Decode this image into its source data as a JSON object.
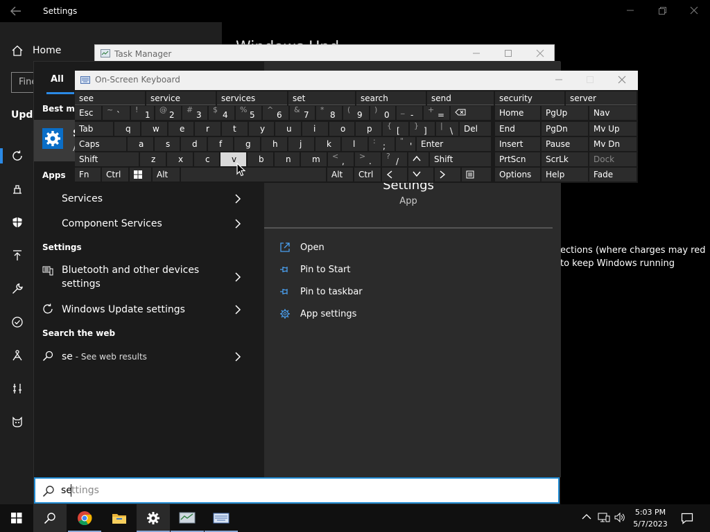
{
  "settings": {
    "title": "Settings",
    "home_label": "Home",
    "find_placeholder": "Fine",
    "section_heading": "Upda",
    "bg_heading": "Windows Upd",
    "bg_text": "ections (where charges may red to keep Windows running"
  },
  "task_manager": {
    "title": "Task Manager"
  },
  "start_menu": {
    "tab_all": "All",
    "best_match_label": "Best ma",
    "best_match_name": "S",
    "best_match_sub": "A",
    "apps_label": "Apps",
    "apps": [
      {
        "label": "Services"
      },
      {
        "label": "Component Services"
      }
    ],
    "settings_label": "Settings",
    "settings_items": [
      {
        "label": "Bluetooth and other devices",
        "label2": "settings"
      },
      {
        "label": "Windows Update settings"
      }
    ],
    "web_label": "Search the web",
    "web_query": "se",
    "web_suffix": " - See web results",
    "preview": {
      "title": "Settings",
      "subtitle": "App",
      "actions": [
        {
          "label": "Open",
          "icon": "open-icon"
        },
        {
          "label": "Pin to Start",
          "icon": "pin-icon"
        },
        {
          "label": "Pin to taskbar",
          "icon": "pin-icon"
        },
        {
          "label": "App settings",
          "icon": "gear-icon"
        }
      ]
    }
  },
  "search": {
    "typed": "se",
    "completion": "ttings"
  },
  "osk": {
    "title": "On-Screen Keyboard",
    "suggestions": [
      "see",
      "service",
      "services",
      "set",
      "search",
      "send",
      "security",
      "server"
    ],
    "rows": [
      [
        "Esc",
        "~ `",
        "! 1",
        "@ 2",
        "# 3",
        "$ 4",
        "% 5",
        "^ 6",
        "& 7",
        "* 8",
        "( 9",
        ") 0",
        "_ -",
        "+ =",
        "backspace"
      ],
      [
        "Tab",
        "q",
        "w",
        "e",
        "r",
        "t",
        "y",
        "u",
        "i",
        "o",
        "p",
        "{ [",
        "} ]",
        "| \\",
        "Del"
      ],
      [
        "Caps",
        "a",
        "s",
        "d",
        "f",
        "g",
        "h",
        "j",
        "k",
        "l",
        ": ;",
        "\" '",
        "Enter"
      ],
      [
        "Shift",
        "z",
        "x",
        "c",
        "v",
        "b",
        "n",
        "m",
        "< ,",
        "> .",
        "? /",
        "^",
        "Shift"
      ],
      [
        "Fn",
        "Ctrl",
        "win",
        "Alt",
        "",
        "Alt",
        "Ctrl",
        "<",
        "v",
        ">",
        "menu"
      ]
    ],
    "nav_keys": [
      [
        "Home",
        "PgUp",
        "Nav"
      ],
      [
        "End",
        "PgDn",
        "Mv Up"
      ],
      [
        "Insert",
        "Pause",
        "Mv Dn"
      ],
      [
        "PrtScn",
        "ScrLk",
        "Dock"
      ],
      [
        "Options",
        "Help",
        "Fade"
      ]
    ],
    "pressed_key": "v"
  },
  "taskbar": {
    "time": "5:03 PM",
    "date": "5/7/2023",
    "apps": [
      "chrome-icon",
      "file-explorer-icon",
      "settings-icon",
      "task-manager-icon",
      "on-screen-keyboard-icon"
    ]
  },
  "colors": {
    "accent": "#2b8ae6",
    "search_border": "#1f8ad2",
    "settings_icon_bg": "#0a6ec7"
  }
}
